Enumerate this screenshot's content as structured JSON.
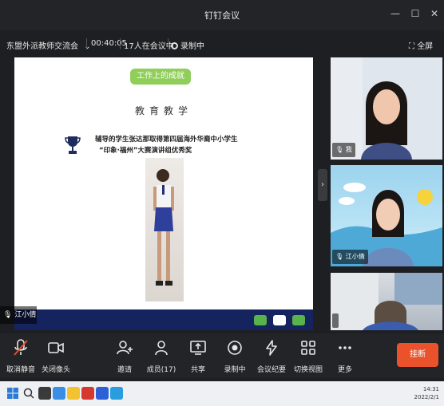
{
  "window": {
    "title": "钉钉会议",
    "minimize_icon": "minimize-icon",
    "maximize_icon": "maximize-icon",
    "close_icon": "close-icon"
  },
  "infobar": {
    "group_name": "东盟外派教师交流会",
    "duration": "00:40:05",
    "participants_in_meeting": "17人在会议中",
    "recording_status": "录制中",
    "fullscreen_label": "全屏"
  },
  "shared_screen": {
    "tag": "工作上的成就",
    "heading": "教育教学",
    "line1": "辅导的学生张达那取得第四届海外华裔中小学生",
    "line2": "“印象·福州”大赛演讲组优秀奖",
    "presenter": "江小倩"
  },
  "video_tiles": [
    {
      "name": "我"
    },
    {
      "name": "江小倩"
    },
    {
      "name": ""
    }
  ],
  "toolbar": {
    "mute": "取消静音",
    "camera": "关闭像头",
    "invite": "邀请",
    "members": "成员(17)",
    "share": "共享",
    "recording": "录制中",
    "minutes": "会议纪要",
    "switch_view": "切换视图",
    "more": "更多",
    "leave": "挂断"
  },
  "taskbar": {
    "time": "14:31",
    "date": "2022/2/1"
  },
  "colors": {
    "accent_green": "#8fce5a",
    "leave_red": "#e9522b",
    "share_bar": "#15235e"
  }
}
